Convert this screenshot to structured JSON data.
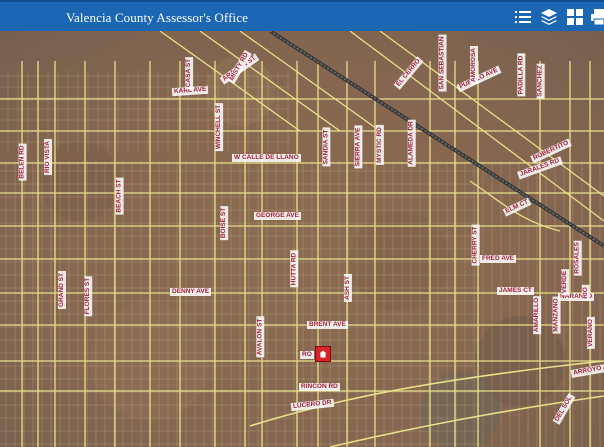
{
  "header": {
    "title": "Valencia County Assessor's Office",
    "icons": [
      "list-icon",
      "layers-icon",
      "basemap-gallery-icon",
      "print-icon"
    ]
  },
  "map": {
    "base_color": "#8a6a50",
    "road_color": "#e7e08a",
    "parcel_color": "#c9b98c",
    "selection_color": "#d8232a",
    "street_labels": {
      "karl": "KARL AVE",
      "calle_de_llano": "W CALLE DE LLANO",
      "george": "GEORGE AVE",
      "denny": "DENNY AVE",
      "brent": "BRENT AVE",
      "rincon": "RINCON RD",
      "lucero": "LUCERO DR",
      "fred": "FRED AVE",
      "james": "JAMES CT",
      "naranjo": "NARANJO",
      "arroyo": "ARROYO AVE",
      "flores": "FLORES ST",
      "grand": "GRAND ST",
      "avalon": "AVALON ST",
      "ash": "ASH ST",
      "hutta": "HUTTA RD",
      "boise": "BOISE ST",
      "winchell": "WINCHELL ST",
      "cherry": "CHERRY ST",
      "amarillo": "AMARILLO",
      "manzano": "MANZANO",
      "verde": "VERDE",
      "elm": "ELM CT",
      "jarales": "JARALES RD",
      "beach": "BEACH ST",
      "belen": "BELEN RD",
      "rio_vista": "RIO VISTA",
      "robertito": "ROBERTITO",
      "pueblo": "PUEBLO AVE",
      "san_sebastian": "SAN SEBASTIAN",
      "padilla": "PADILLA RD",
      "amorosa": "AMOROSA",
      "sanchez": "SANCHEZ",
      "aragon": "ARAGON ST",
      "casa": "CASA ST",
      "misty": "MISTY RD",
      "el_cerro": "EL CERRO",
      "sandia": "SANDIA ST",
      "sierra": "SIERRA AVE",
      "mystic": "MYSTIC RD",
      "alameda": "ALAMEDA DR",
      "rosales": "ROSALES",
      "rio": "RIO",
      "verano": "VERANO",
      "del_sol": "DEL SOL"
    },
    "selected_parcel_label": "RO"
  }
}
